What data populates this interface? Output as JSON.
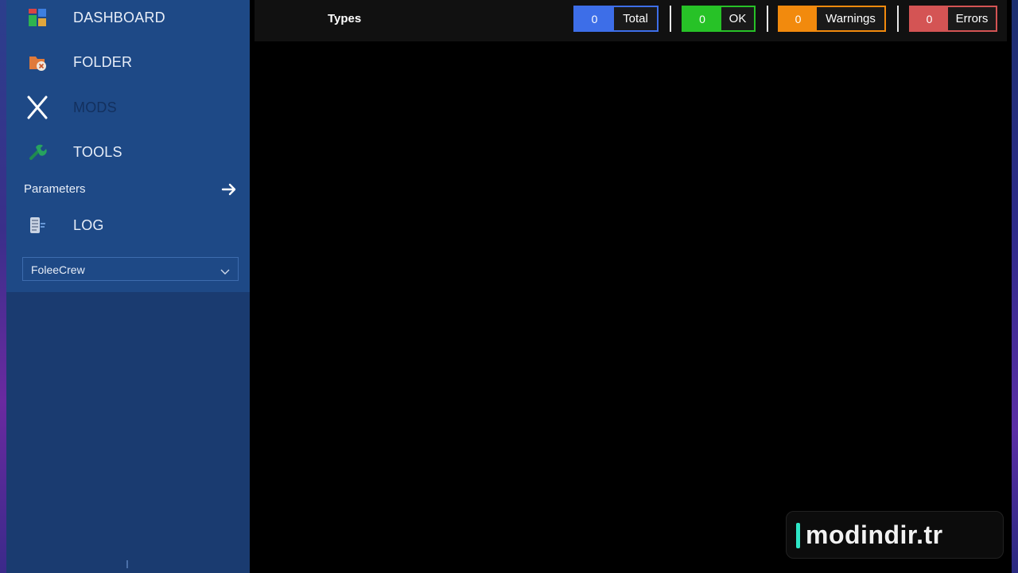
{
  "sidebar": {
    "items": [
      {
        "label": "DASHBOARD",
        "icon": "dashboard-icon"
      },
      {
        "label": "FOLDER",
        "icon": "folder-icon"
      },
      {
        "label": "MODS",
        "icon": "close-x-icon"
      },
      {
        "label": "TOOLS",
        "icon": "tools-icon"
      },
      {
        "label": "LOG",
        "icon": "log-icon"
      }
    ],
    "parameters_label": "Parameters",
    "profile_select": {
      "value": "FoleeCrew"
    }
  },
  "topbar": {
    "types_label": "Types",
    "counters": [
      {
        "count": "0",
        "label": "Total",
        "color": "#3d6ee8"
      },
      {
        "count": "0",
        "label": "OK",
        "color": "#27c227"
      },
      {
        "count": "0",
        "label": "Warnings",
        "color": "#f28a0d"
      },
      {
        "count": "0",
        "label": "Errors",
        "color": "#d45454"
      }
    ]
  },
  "watermark": {
    "text": "modindir.tr"
  }
}
